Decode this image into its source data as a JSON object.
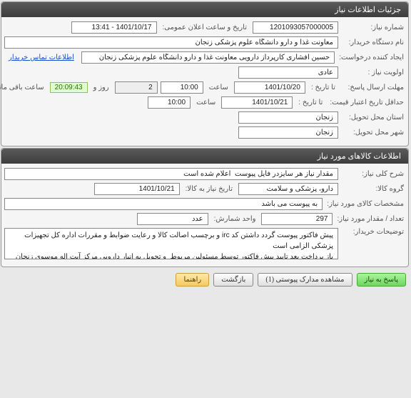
{
  "panel1": {
    "title": "جزئیات اطلاعات نیاز",
    "labels": {
      "request_no": "شماره نیاز:",
      "public_dt": "تاریخ و ساعت اعلان عمومی:",
      "buyer_org": "نام دستگاه خریدار:",
      "creator": "ایجاد کننده درخواست:",
      "priority": "اولویت نیاز :",
      "answer_deadline": "مهلت ارسال پاسخ:",
      "credit_deadline": "حداقل تاریخ اعتبار قیمت:",
      "delivery_province": "استان محل تحویل:",
      "delivery_city": "شهر محل تحویل:",
      "to_date": "تا تاریخ :",
      "hour": "ساعت",
      "days_and": "روز و",
      "hours_remain": "ساعت باقی مانده"
    },
    "values": {
      "request_no": "1201093057000005",
      "public_dt": "1401/10/17 - 13:41",
      "buyer_org": "معاونت غذا و دارو دانشگاه علوم پزشکی زنجان",
      "creator": "حسین افشاری کارپرداز دارویی معاونت غذا و دارو دانشگاه علوم پزشکی زنجان",
      "priority": "عادی",
      "deadline_date": "1401/10/20",
      "deadline_time": "10:00",
      "days_remain": "2",
      "countdown": "20:09:43",
      "credit_date": "1401/10/21",
      "credit_time": "10:00",
      "province": "زنجان",
      "city": "زنجان"
    },
    "contact_link": "اطلاعات تماس خریدار"
  },
  "panel2": {
    "title": "اطلاعات کالاهای مورد نیاز",
    "labels": {
      "general_desc": "شرح کلی نیاز:",
      "goods_group": "گروه کالا:",
      "need_date": "تاریخ نیاز به کالا:",
      "goods_spec": "مشخصات کالای مورد نیاز:",
      "qty": "تعداد / مقدار مورد نیاز:",
      "unit": "واحد شمارش:",
      "buyer_notes": "توضیحات خریدار:"
    },
    "values": {
      "general_desc": "مقدار نیاز هر سایزدر فایل پیوست  اعلام شده است",
      "goods_group": "دارو، پزشکی و سلامت",
      "need_date": "1401/10/21",
      "goods_spec": "به پیوست می باشد",
      "qty": "297",
      "unit": "عدد",
      "buyer_notes": "پیش فاکتور پیوست گردد داشتن کد irc و برچسب اصالت کالا و رعایت ضوابط و مقررات اداره کل تجهیزات پزشکی الزامی است\nباز پرداخت بعد تایید پیش فاکتور توسط مسئولین مربوط  و تحویل به انبار دارویی مرکز آیت اله موسوی زنجان  به صورت نقدی می باشد"
    }
  },
  "buttons": {
    "respond": "پاسخ به نیاز",
    "attachments": "مشاهده مدارک پیوستی (1)",
    "back": "بازگشت",
    "help": "راهنما"
  }
}
